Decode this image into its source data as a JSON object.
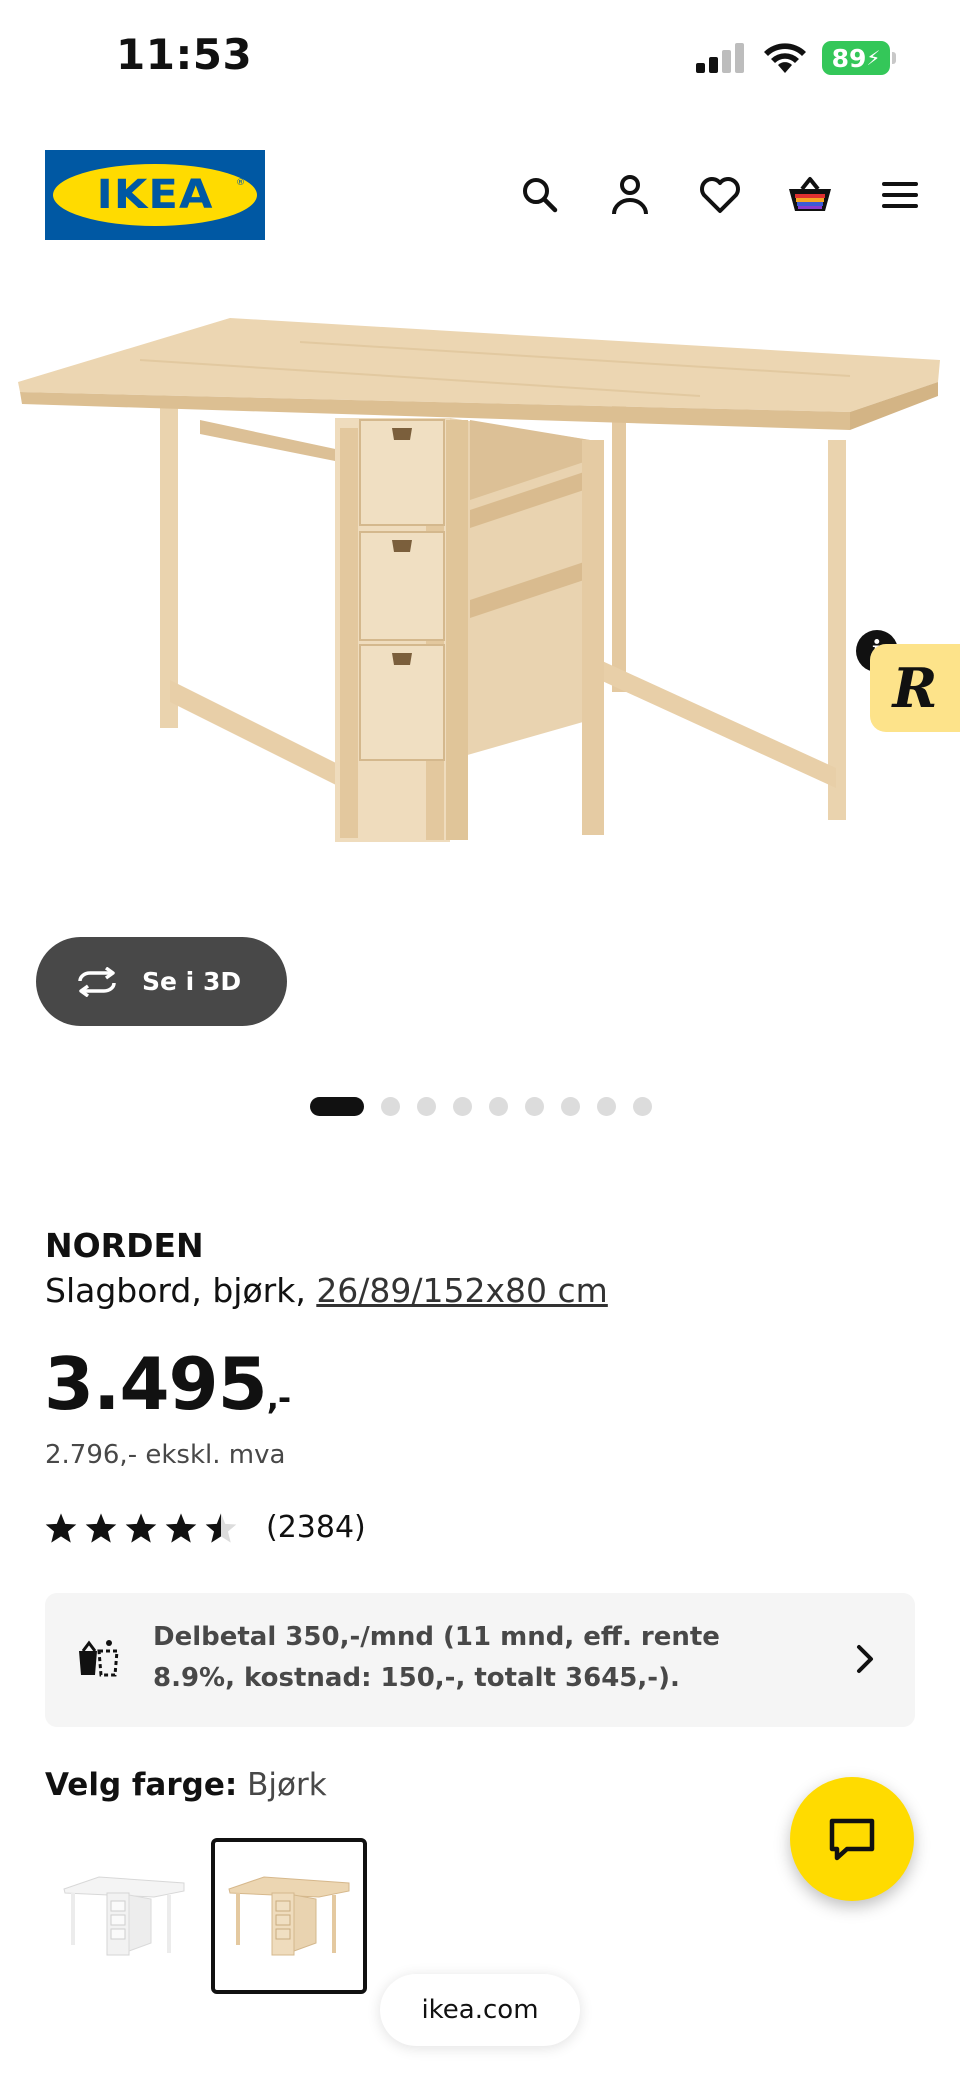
{
  "status_bar": {
    "time": "11:53",
    "battery": "89"
  },
  "header": {
    "logo_text": "IKEA",
    "icons": [
      "search-icon",
      "account-icon",
      "heart-icon",
      "basket-icon",
      "menu-icon"
    ]
  },
  "gallery": {
    "view_3d_label": "Se i 3D",
    "slide_count": 9,
    "active_slide": 1
  },
  "product": {
    "name": "NORDEN",
    "description": "Slagbord, bjørk, ",
    "dimensions": "26/89/152x80 cm",
    "price_main": "3.495",
    "price_suffix": ",-",
    "price_ex_vat": "2.796,- ekskl. mva",
    "rating_value": 4.5,
    "rating_max": 5,
    "review_count": "(2384)"
  },
  "installment": {
    "text": "Delbetal 350,-/mnd (11 mnd, eff. rente 8.9%, kostnad: 150,-, totalt 3645,-)."
  },
  "color_picker": {
    "label": "Velg farge:",
    "selected": "Bjørk",
    "options": [
      "white",
      "birch"
    ]
  },
  "browser": {
    "url": "ikea.com"
  },
  "colors": {
    "ikea_blue": "#0058a3",
    "ikea_yellow": "#ffdb00",
    "wood": "#e9d1ad",
    "battery_green": "#34c759"
  }
}
